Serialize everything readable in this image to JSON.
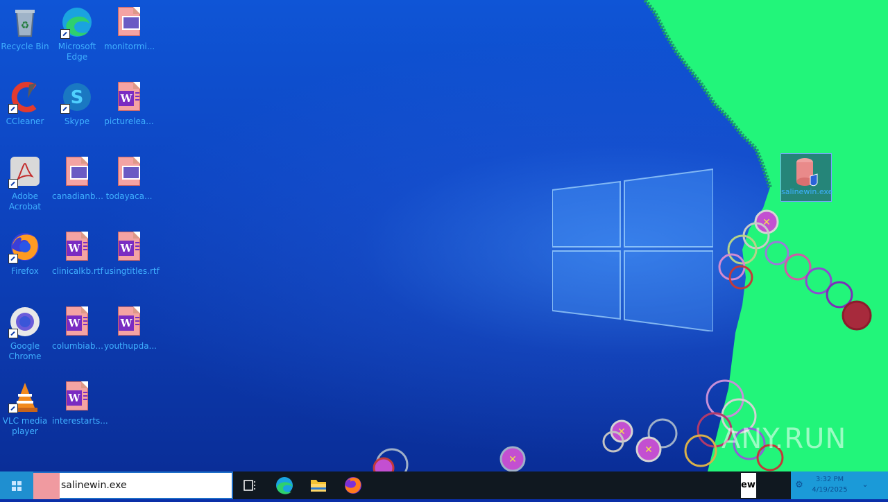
{
  "desktop_icons": [
    {
      "label": "Recycle Bin"
    },
    {
      "label": "Microsoft Edge"
    },
    {
      "label": "monitormi..."
    },
    {
      "label": "CCleaner"
    },
    {
      "label": "Skype"
    },
    {
      "label": "picturelea..."
    },
    {
      "label": "Adobe Acrobat"
    },
    {
      "label": "canadianb..."
    },
    {
      "label": "todayaca..."
    },
    {
      "label": "Firefox"
    },
    {
      "label": "clinicalkb.rtf"
    },
    {
      "label": "usingtitles.rtf"
    },
    {
      "label": "Google Chrome"
    },
    {
      "label": "columbiab..."
    },
    {
      "label": "youthupda..."
    },
    {
      "label": "VLC media player"
    },
    {
      "label": "interestarts..."
    }
  ],
  "selected_file": {
    "label": "salinewin.exe"
  },
  "taskbar": {
    "search_value": "salinewin.exe",
    "tray_app_text": "ewi",
    "clock_time": "3:32 PM",
    "clock_date": "4/19/2025"
  },
  "watermark": "ANY.RUN",
  "colors": {
    "taskbar": "#101820",
    "accent": "#1f8fd0",
    "icon_text": "#3fb0ff",
    "payload_green": "#22f57a",
    "bubble_fill": "#c34fd1"
  }
}
